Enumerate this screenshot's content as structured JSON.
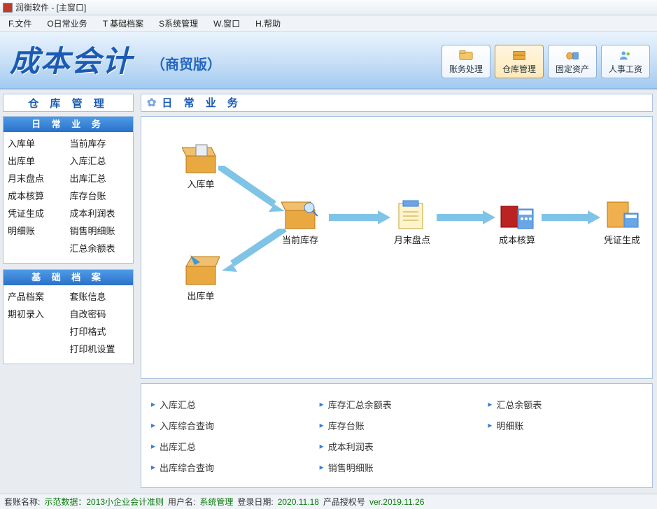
{
  "title": "润衡软件 - [主窗口]",
  "menu": [
    "F.文件",
    "O日常业务",
    "T 基础档案",
    "S系统管理",
    "W.窗口",
    "H.帮助"
  ],
  "banner": {
    "title": "成本会计",
    "subtitle": "（商贸版）"
  },
  "banner_buttons": [
    {
      "label": "账务处理",
      "active": false
    },
    {
      "label": "仓库管理",
      "active": true
    },
    {
      "label": "固定资产",
      "active": false
    },
    {
      "label": "人事工资",
      "active": false
    }
  ],
  "sidebar": {
    "title": "仓 库 管 理",
    "daily": {
      "title": "日 常 业 务",
      "items": [
        "入库单",
        "当前库存",
        "出库单",
        "入库汇总",
        "月末盘点",
        "出库汇总",
        "成本核算",
        "库存台账",
        "凭证生成",
        "成本利润表",
        "明细账",
        "销售明细账",
        "",
        "汇总余额表"
      ]
    },
    "base": {
      "title": "基 础 档 案",
      "items": [
        "产品档案",
        "套账信息",
        "期初录入",
        "自改密码",
        "",
        "打印格式",
        "",
        "打印机设置"
      ]
    }
  },
  "main_head": "日 常 业 务",
  "flow_nodes": {
    "in": "入库单",
    "cur": "当前库存",
    "out": "出库单",
    "month": "月末盘点",
    "cost": "成本核算",
    "voucher": "凭证生成"
  },
  "reports": [
    "入库汇总",
    "库存汇总余额表",
    "汇总余额表",
    "入库综合查询",
    "库存台账",
    "明细账",
    "出库汇总",
    "成本利润表",
    "",
    "出库综合查询",
    "销售明细账",
    ""
  ],
  "status": {
    "k1": "套账名称:",
    "v1": "示范数据：2013小企业会计准则",
    "k2": "用户名:",
    "v2": "系统管理",
    "k3": "登录日期:",
    "v3": "2020.11.18",
    "k4": "产品授权号",
    "v4": "ver.2019.11.26"
  }
}
